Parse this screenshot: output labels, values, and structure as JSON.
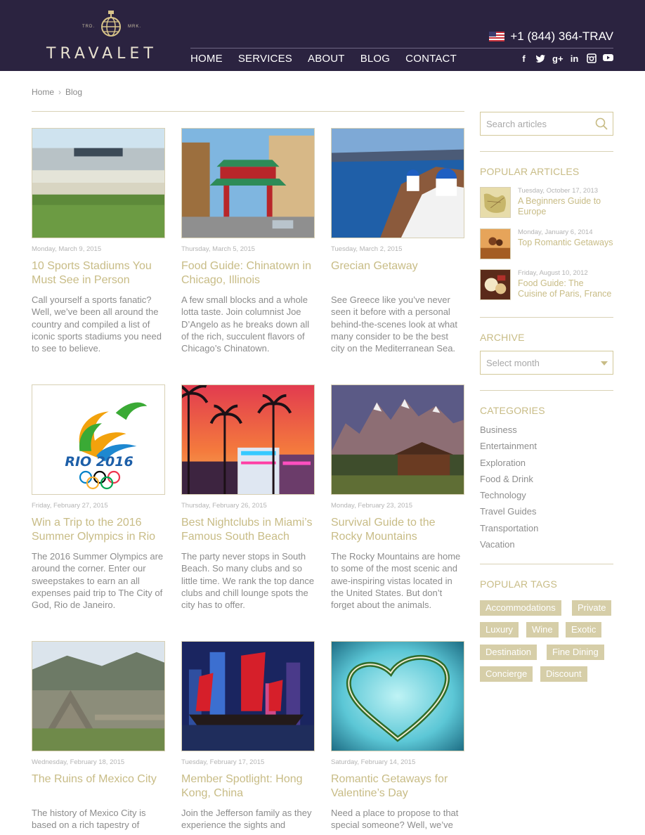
{
  "brand": {
    "name": "TRAVALET",
    "tm_left": "TRD.",
    "tm_right": "MRK."
  },
  "header": {
    "phone": "+1 (844) 364-TRAV",
    "nav": [
      "HOME",
      "SERVICES",
      "ABOUT",
      "BLOG",
      "CONTACT"
    ],
    "social": [
      "facebook-icon",
      "twitter-icon",
      "google-plus-icon",
      "linkedin-icon",
      "instagram-icon",
      "youtube-icon"
    ]
  },
  "breadcrumb": {
    "home": "Home",
    "current": "Blog"
  },
  "posts": [
    {
      "date": "Monday, March 9, 2015",
      "title": "10 Sports Stadiums You Must See in Person",
      "excerpt": "Call yourself a sports fanatic? Well, we’ve been all around the country and compiled a list of iconic sports stadiums you need to see to believe."
    },
    {
      "date": "Thursday, March 5, 2015",
      "title": "Food Guide: Chinatown in Chicago, Illinois",
      "excerpt": "A few small blocks and a whole lotta taste. Join columnist Joe D’Angelo as he breaks down all of the rich, succulent flavors of Chicago’s Chinatown."
    },
    {
      "date": "Tuesday, March 2, 2015",
      "title": "Grecian Getaway",
      "excerpt": "See Greece like you’ve never seen it before with a personal behind-the-scenes look at what many consider to be the best city on the Mediterranean Sea."
    },
    {
      "date": "Friday, February 27, 2015",
      "title": "Win a Trip to the 2016 Summer Olympics in Rio",
      "excerpt": "The 2016 Summer Olympics are around the corner. Enter our sweepstakes to earn an all expenses paid trip to The City of God, Rio de Janeiro.",
      "logo_text": "RIO 2016"
    },
    {
      "date": "Thursday, February 26, 2015",
      "title": "Best Nightclubs in Miami’s Famous South Beach",
      "excerpt": "The party never stops in South Beach.  So many clubs and so little time. We rank the top dance clubs and chill lounge spots the city has to offer."
    },
    {
      "date": "Monday, February 23, 2015",
      "title": "Survival Guide to the Rocky Mountains",
      "excerpt": "The Rocky Mountains are home to some of the most scenic and awe-inspiring vistas located in the United States. But don’t forget about the animals."
    },
    {
      "date": "Wednesday, February 18, 2015",
      "title": "The Ruins of Mexico City",
      "excerpt": "The history of Mexico City is based on a rich tapestry of"
    },
    {
      "date": "Tuesday, February 17, 2015",
      "title": "Member Spotlight: Hong Kong, China",
      "excerpt": "Join the Jefferson family as they experience the sights and"
    },
    {
      "date": "Saturday, February 14, 2015",
      "title": "Romantic Getaways for Valentine’s Day",
      "excerpt": "Need a place to propose to that special someone? Well, we’ve"
    }
  ],
  "sidebar": {
    "search_placeholder": "Search articles",
    "popular_heading": "POPULAR ARTICLES",
    "popular": [
      {
        "date": "Tuesday, October 17, 2013",
        "title": "A Beginners Guide to Europe"
      },
      {
        "date": "Monday, January 6, 2014",
        "title": "Top Romantic Getaways"
      },
      {
        "date": "Friday, August 10, 2012",
        "title": "Food Guide: The Cuisine of Paris, France"
      }
    ],
    "archive_heading": "ARCHIVE",
    "archive_select": "Select month",
    "categories_heading": "CATEGORIES",
    "categories": [
      "Business",
      "Entertainment",
      "Exploration",
      "Food & Drink",
      "Technology",
      "Travel Guides",
      "Transportation",
      "Vacation"
    ],
    "tags_heading": "POPULAR TAGS",
    "tags": [
      "Accommodations",
      "Private",
      "Luxury",
      "Wine",
      "Exotic",
      "Destination",
      "Fine Dining",
      "Concierge",
      "Discount"
    ]
  },
  "colors": {
    "header_bg": "#2b2340",
    "accent": "#c8bc86",
    "tag_bg": "#d6cea8"
  }
}
